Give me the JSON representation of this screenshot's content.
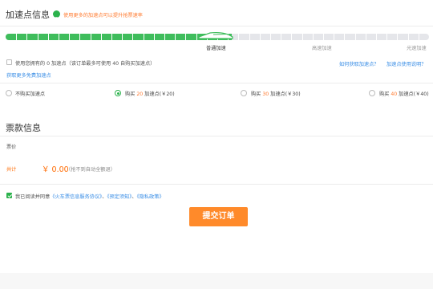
{
  "accel_section": {
    "title": "加速点信息",
    "hint": "使用更多的加速点可以提升抢票速率",
    "progress_value": 0.535,
    "speed_labels": [
      "普通加速",
      "高速加速",
      "光速加速"
    ],
    "use_owned_text": "使用您拥有的 0 加速点（该订单最多可使用 40 自购买加速点）",
    "get_free_link": "获取更多免费加速点",
    "how_to_get_link": "如何获取加速点？",
    "usage_rules_link": "加速点使用说明？",
    "purchase_options": [
      {
        "prefix": "不购买加速点",
        "num": "",
        "suffix": ""
      },
      {
        "prefix": "购买 ",
        "num": "20",
        "suffix": " 加速点(￥20)"
      },
      {
        "prefix": "购买 ",
        "num": "30",
        "suffix": " 加速点(￥30)"
      },
      {
        "prefix": "购买 ",
        "num": "40",
        "suffix": " 加速点(￥40)"
      }
    ],
    "selected_option_index": 1
  },
  "payment_section": {
    "title": "票款信息",
    "price_label": "票价",
    "total_label": "共计",
    "total_amount": "￥ 0.00",
    "total_note": "（抢不到自动全额退）"
  },
  "agreement": {
    "text": "我已阅读并同意",
    "links": [
      "《火车票信息服务协议》",
      "、",
      "《预定须知》",
      "、",
      "《隐私政策》"
    ],
    "checked": true
  },
  "submit_label": "提交订单",
  "colors": {
    "accent_green": "#2bb24c",
    "accent_orange": "#ff8a2a",
    "link_blue": "#3a8ee6"
  }
}
